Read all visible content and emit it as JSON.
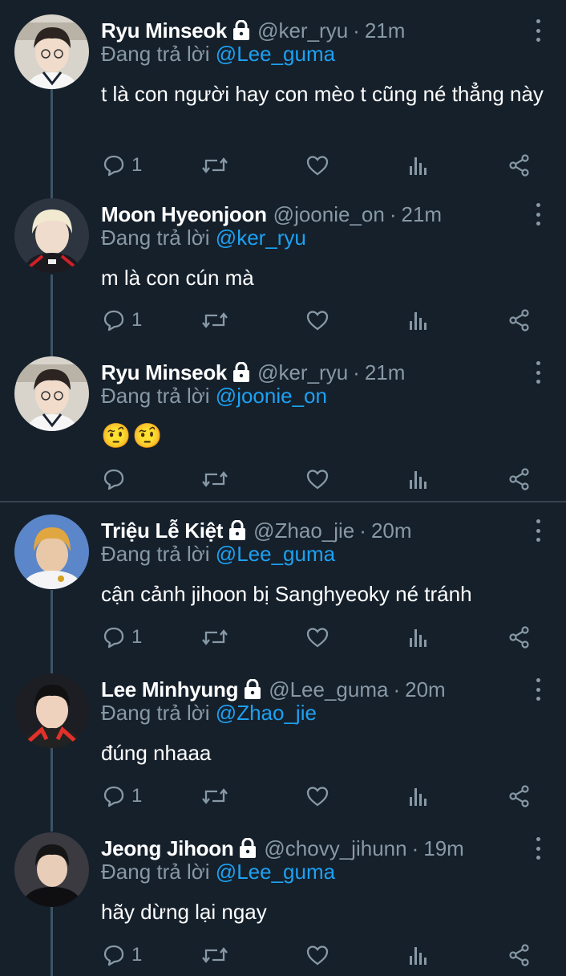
{
  "reply_prefix": "Đang trả lời",
  "colors": {
    "background": "#15202b",
    "accent": "#1da1f2",
    "muted": "#8899a6",
    "thread_line": "#3d5466"
  },
  "icons": [
    "lock-icon",
    "more-vertical-icon",
    "reply-icon",
    "retweet-icon",
    "like-icon",
    "analytics-icon",
    "share-icon"
  ],
  "tweets": [
    {
      "name": "Ryu Minseok",
      "handle": "@ker_ryu",
      "sep": "·",
      "time": "21m",
      "reply_to": "@Lee_guma",
      "text": "t là con người hay con mèo t cũng né thẳng này",
      "replies": "1"
    },
    {
      "name": "Moon Hyeonjoon",
      "handle": "@joonie_on",
      "sep": "·",
      "time": "21m",
      "reply_to": "@ker_ryu",
      "text": "m là con cún mà",
      "replies": "1"
    },
    {
      "name": "Ryu Minseok",
      "handle": "@ker_ryu",
      "sep": "·",
      "time": "21m",
      "reply_to": "@joonie_on",
      "text": "🤨🤨",
      "replies": ""
    },
    {
      "name": "Triệu Lễ Kiệt",
      "handle": "@Zhao_jie",
      "sep": "·",
      "time": "20m",
      "reply_to": "@Lee_guma",
      "text": "cận cảnh jihoon bị Sanghyeoky né tránh",
      "replies": "1"
    },
    {
      "name": "Lee Minhyung",
      "handle": "@Lee_guma",
      "sep": "·",
      "time": "20m",
      "reply_to": "@Zhao_jie",
      "text": "đúng nhaaa",
      "replies": "1"
    },
    {
      "name": "Jeong Jihoon",
      "handle": "@chovy_jihunn",
      "sep": "·",
      "time": "19m",
      "reply_to": "@Lee_guma",
      "text": "hãy dừng lại ngay",
      "replies": "1"
    }
  ]
}
